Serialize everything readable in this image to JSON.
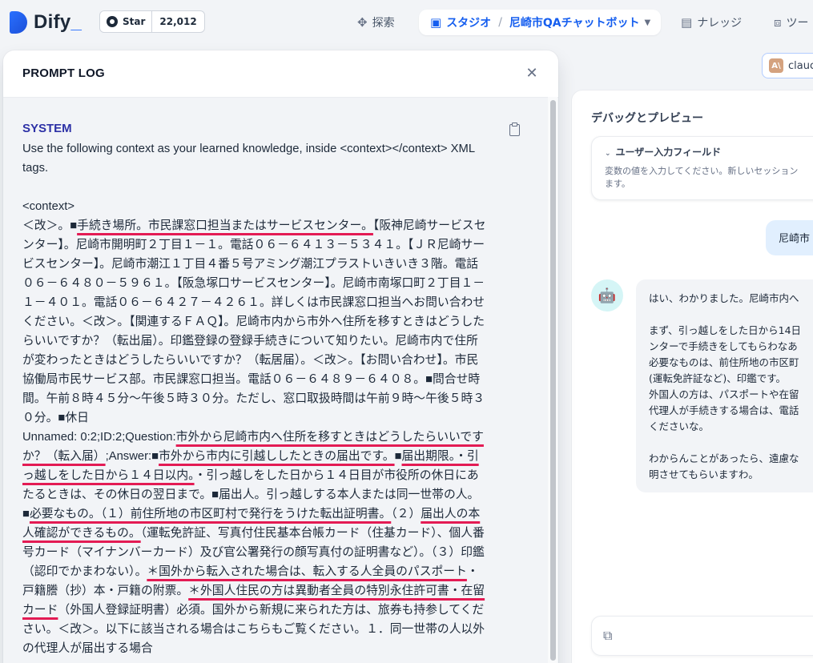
{
  "header": {
    "logo_text": "Dify",
    "github": {
      "star_label": "Star",
      "star_count": "22,012"
    },
    "nav": {
      "explore": "探索",
      "studio": "スタジオ",
      "app_name": "尼崎市QAチャットボット",
      "knowledge": "ナレッジ",
      "tools": "ツー"
    }
  },
  "model_chip": {
    "label": "clauc"
  },
  "debug": {
    "title": "デバッグとプレビュー",
    "user_input_field": {
      "title": "ユーザー入力フィールド",
      "description": "変数の値を入力してください。新しいセッション\nます。"
    },
    "user_message": "尼崎市",
    "bot_message": "はい、わかりました。尼崎市内へ\n\nまず、引っ越しをした日から14日\nンターで手続きをしてもらわなあ\n必要なものは、前住所地の市区町\n(運転免許証など)、印鑑です。\n外国人の方は、パスポートや在留\n代理人が手続きする場合は、電話\nくださいな。\n\nわからんことがあったら、遠慮な\n明させてもらいますわ。"
  },
  "prompt_log": {
    "title": "PROMPT LOG",
    "role": "SYSTEM",
    "lines": [
      {
        "segments": [
          {
            "t": "Use the following context as your learned knowledge, inside <context></context> XML"
          }
        ]
      },
      {
        "segments": [
          {
            "t": "tags."
          }
        ]
      },
      {
        "segments": [
          {
            "t": ""
          }
        ]
      },
      {
        "segments": [
          {
            "t": "<context>"
          }
        ]
      },
      {
        "segments": [
          {
            "t": "＜改＞。■"
          },
          {
            "t": "手続き場所。市民課窓口担当またはサービスセンター。",
            "u": true
          },
          {
            "t": "【阪神尼崎サービスセ"
          }
        ]
      },
      {
        "segments": [
          {
            "t": "ンター】。尼崎市開明町２丁目１－１。電話０６－６４１３－５３４１。【ＪＲ尼崎サー"
          }
        ]
      },
      {
        "segments": [
          {
            "t": "ビスセンター】。尼崎市潮江１丁目４番５号アミング潮江プラストいきいき３階。電話"
          }
        ]
      },
      {
        "segments": [
          {
            "t": "０６－６４８０－５９６１。【阪急塚口サービスセンター】。尼崎市南塚口町２丁目１－"
          }
        ]
      },
      {
        "segments": [
          {
            "t": "１－４０１。電話０６－６４２７－４２６１。詳しくは市民課窓口担当へお問い合わせ"
          }
        ]
      },
      {
        "segments": [
          {
            "t": "ください。＜改＞。【関連するＦＡＱ】。尼崎市内から市外へ住所を移すときはどうした"
          }
        ]
      },
      {
        "segments": [
          {
            "t": "らいいですか？（転出届）。印鑑登録の登録手続きについて知りたい。尼崎市内で住所"
          }
        ]
      },
      {
        "segments": [
          {
            "t": "が変わったときはどうしたらいいですか？（転居届）。＜改＞。【お問い合わせ】。市民"
          }
        ]
      },
      {
        "segments": [
          {
            "t": "協働局市民サービス部。市民課窓口担当。電話０６－６４８９－６４０８。■問合せ時"
          }
        ]
      },
      {
        "segments": [
          {
            "t": "間。午前８時４５分～午後５時３０分。ただし、窓口取扱時間は午前９時～午後５時３"
          }
        ]
      },
      {
        "segments": [
          {
            "t": "０分。■休日"
          }
        ]
      },
      {
        "segments": [
          {
            "t": "Unnamed: 0:2;ID:2;Question:"
          },
          {
            "t": "市外から尼崎市内へ住所を移すときはどうしたらいいです",
            "u": true
          }
        ]
      },
      {
        "segments": [
          {
            "t": "か？（転入届）",
            "u": true
          },
          {
            "t": ";Answer:■"
          },
          {
            "t": "市外から市内に引越ししたときの届出です。",
            "u": true
          },
          {
            "t": "■"
          },
          {
            "t": "届出期限。・引",
            "u": true
          }
        ]
      },
      {
        "segments": [
          {
            "t": "っ越しをした日から１４日以内。",
            "u": true
          },
          {
            "t": "・引っ越しをした日から１４日目が市役所の休日にあ"
          }
        ]
      },
      {
        "segments": [
          {
            "t": "たるときは、その休日の翌日まで。■届出人。引っ越しする本人または同一世帯の人。"
          }
        ]
      },
      {
        "segments": [
          {
            "t": "■"
          },
          {
            "t": "必要なもの。（１）前住所地の市区町村で発行をうけた転出証明書。",
            "u": true
          },
          {
            "t": "（２）"
          },
          {
            "t": "届出人の本",
            "u": true
          }
        ]
      },
      {
        "segments": [
          {
            "t": "人確認ができるもの。",
            "u": true
          },
          {
            "t": "（運転免許証、写真付住民基本台帳カード（住基カード）、個人番"
          }
        ]
      },
      {
        "segments": [
          {
            "t": "号カード（マイナンバーカード）及び官公署発行の顔写真付の証明書など）。（３）印鑑"
          }
        ]
      },
      {
        "segments": [
          {
            "t": "（認印でかまわない）。"
          },
          {
            "t": "＊国外から転入された場合は、転入する人全員のパスポート",
            "u": true
          },
          {
            "t": "・"
          }
        ]
      },
      {
        "segments": [
          {
            "t": "戸籍謄（抄）本・戸籍の附票。"
          },
          {
            "t": "＊外国人住民の方は異動者全員の特別永住許可書・在留",
            "u": true
          }
        ]
      },
      {
        "segments": [
          {
            "t": "カード",
            "u": true
          },
          {
            "t": "（外国人登録証明書）必須。国外から新規に来られた方は、旅券も持参してくだ"
          }
        ]
      },
      {
        "segments": [
          {
            "t": "さい。＜改＞。以下に該当される場合はこちらもご覧ください。１．同一世帯の人以外"
          }
        ]
      },
      {
        "segments": [
          {
            "t": "の代理人が届出する場合"
          }
        ]
      }
    ]
  },
  "icons": {
    "explore": "explore-icon",
    "studio": "robot-icon",
    "knowledge": "book-icon",
    "tools": "toolbox-icon",
    "close": "close-icon",
    "copy": "copy-icon"
  },
  "colors": {
    "accent": "#155eef",
    "system_label": "#2d31a6",
    "underline": "#e31b54"
  }
}
